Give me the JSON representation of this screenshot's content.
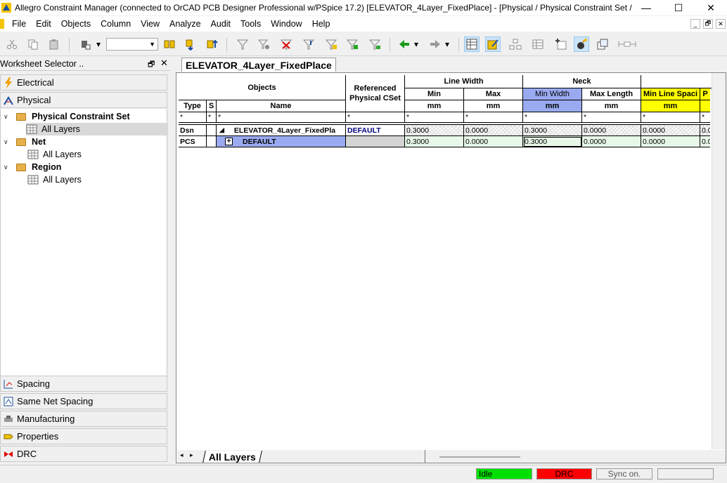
{
  "window": {
    "title": "Allegro Constraint Manager (connected to OrCAD PCB Designer Professional w/PSpice 17.2) [ELEVATOR_4Layer_FixedPlace] - [Physical / Physical Constraint Set / All...",
    "minimize": "—",
    "maximize": "☐",
    "close": "✕"
  },
  "menu": [
    "File",
    "Edit",
    "Objects",
    "Column",
    "View",
    "Analyze",
    "Audit",
    "Tools",
    "Window",
    "Help"
  ],
  "mdi_controls": [
    "_",
    "🗗",
    "✕"
  ],
  "worksheet_selector": {
    "title": "Worksheet Selector ..",
    "pin": "🗗",
    "close": "✕",
    "categories_top": [
      "Electrical",
      "Physical"
    ],
    "tree": [
      {
        "label": "Physical Constraint Set",
        "bold": true
      },
      {
        "label": "All Layers",
        "selected": true
      },
      {
        "label": "Net",
        "bold": true
      },
      {
        "label": "All Layers"
      },
      {
        "label": "Region",
        "bold": true
      },
      {
        "label": "All Layers"
      }
    ],
    "categories_bottom": [
      "Spacing",
      "Same Net Spacing",
      "Manufacturing",
      "Properties",
      "DRC"
    ]
  },
  "document_tab": "ELEVATOR_4Layer_FixedPlace",
  "grid": {
    "headers": {
      "objects": "Objects",
      "referenced": "Referenced Physical CSet",
      "line_width": "Line Width",
      "neck": "Neck",
      "type": "Type",
      "s": "S",
      "name": "Name",
      "min": "Min",
      "max": "Max",
      "min_width": "Min Width",
      "max_length": "Max Length",
      "min_line_spacing": "Min Line Spaci",
      "next_col": "P",
      "unit": "mm"
    },
    "filter": "*",
    "rows": [
      {
        "type": "Dsn",
        "expander": "◢",
        "name": "ELEVATOR_4Layer_FixedPla",
        "ref": "DEFAULT",
        "min": "0.3000",
        "max": "0.0000",
        "min_width": "0.3000",
        "max_length": "0.0000",
        "min_line_spacing": "0.0000",
        "next": "0.0"
      },
      {
        "type": "PCS",
        "expander": "+",
        "name": "DEFAULT",
        "ref": "",
        "min": "0.3000",
        "max": "0.0000",
        "min_width": "0.3000",
        "max_length": "0.0000",
        "min_line_spacing": "0.0000",
        "next": "0.0"
      }
    ]
  },
  "bottom_tab": "All Layers",
  "status": {
    "idle": "Idle",
    "drc": "DRC",
    "sync": "Sync on.",
    "idle_color": "#00e000",
    "drc_color": "#ff0000"
  }
}
